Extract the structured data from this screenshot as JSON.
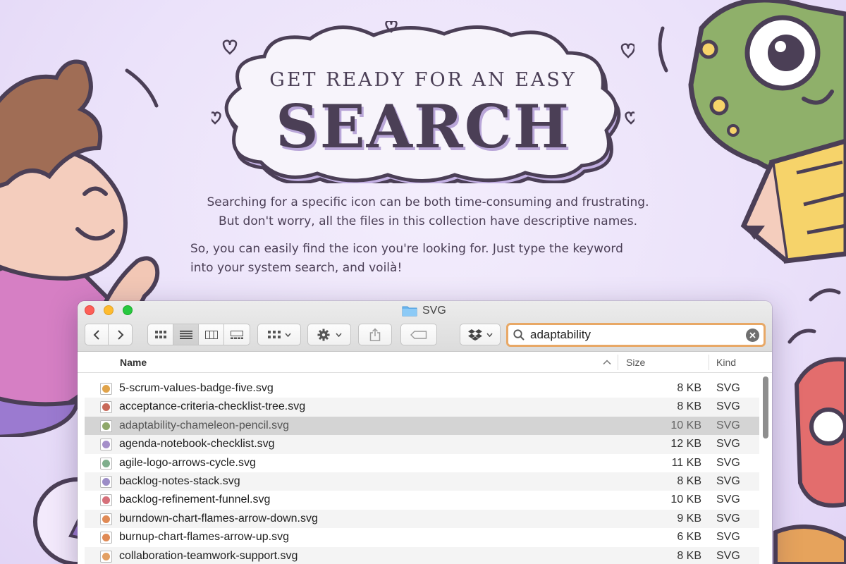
{
  "headline": {
    "small": "GET READY FOR AN EASY",
    "big": "SEARCH"
  },
  "intro": {
    "p1_line1": "Searching for a specific icon can be both time-consuming and frustrating.",
    "p1_line2": "But don't worry, all the files in this collection have descriptive names.",
    "p2_line1": "So, you can easily find the icon you're looking for. Just type the keyword",
    "p2_line2": "into your system search, and voilà!"
  },
  "finder": {
    "title": "SVG",
    "search_value": "adaptability",
    "columns": {
      "name": "Name",
      "size": "Size",
      "kind": "Kind"
    },
    "files": [
      {
        "name": "5-scrum-values-badge-five.svg",
        "size": "8 KB",
        "kind": "SVG",
        "icon_color": "#e0a34a"
      },
      {
        "name": "acceptance-criteria-checklist-tree.svg",
        "size": "8 KB",
        "kind": "SVG",
        "icon_color": "#c96a5a"
      },
      {
        "name": "adaptability-chameleon-pencil.svg",
        "size": "10 KB",
        "kind": "SVG",
        "icon_color": "#8fa86a"
      },
      {
        "name": "agenda-notebook-checklist.svg",
        "size": "12 KB",
        "kind": "SVG",
        "icon_color": "#a58fc9"
      },
      {
        "name": "agile-logo-arrows-cycle.svg",
        "size": "11 KB",
        "kind": "SVG",
        "icon_color": "#7fae8c"
      },
      {
        "name": "backlog-notes-stack.svg",
        "size": "8 KB",
        "kind": "SVG",
        "icon_color": "#9c8dc7"
      },
      {
        "name": "backlog-refinement-funnel.svg",
        "size": "10 KB",
        "kind": "SVG",
        "icon_color": "#d6707a"
      },
      {
        "name": "burndown-chart-flames-arrow-down.svg",
        "size": "9 KB",
        "kind": "SVG",
        "icon_color": "#e08a55"
      },
      {
        "name": "burnup-chart-flames-arrow-up.svg",
        "size": "6 KB",
        "kind": "SVG",
        "icon_color": "#e08a55"
      },
      {
        "name": "collaboration-teamwork-support.svg",
        "size": "8 KB",
        "kind": "SVG",
        "icon_color": "#e3a063"
      }
    ],
    "selected_index": 2
  },
  "colors": {
    "background": "#ede4fa",
    "ink": "#4b3f56",
    "search_focus": "#e8a866",
    "selected_row": "#d4d4d4"
  }
}
